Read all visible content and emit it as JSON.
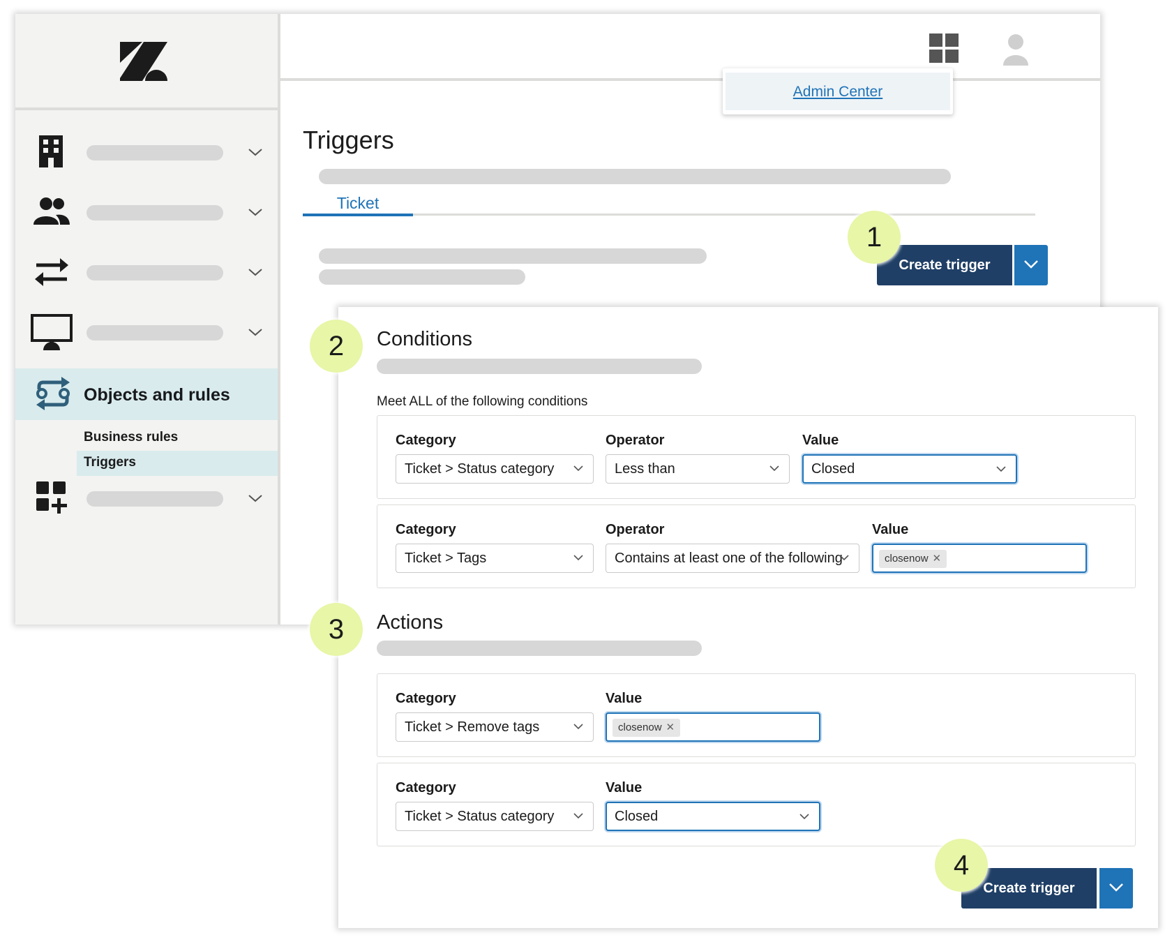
{
  "sidebar": {
    "active_section": "Objects and rules",
    "sub_items": [
      "Business rules",
      "Triggers"
    ],
    "icons": [
      "building-icon",
      "people-icon",
      "arrows-icon",
      "monitor-icon",
      "objects-rules-icon",
      "apps-add-icon"
    ]
  },
  "header": {
    "apps_icon": "grid-icon",
    "user_icon": "user-icon",
    "popover_link": "Admin Center"
  },
  "page": {
    "title": "Triggers",
    "tab": "Ticket",
    "create_button": "Create trigger"
  },
  "badges": [
    "1",
    "2",
    "3",
    "4"
  ],
  "conditions": {
    "title": "Conditions",
    "instruction": "Meet ALL of the following conditions",
    "rows": [
      {
        "category_label": "Category",
        "category": "Ticket > Status category",
        "operator_label": "Operator",
        "operator": "Less than",
        "value_label": "Value",
        "value": "Closed"
      },
      {
        "category_label": "Category",
        "category": "Ticket > Tags",
        "operator_label": "Operator",
        "operator": "Contains at least one of the following",
        "value_label": "Value",
        "tag": "closenow"
      }
    ]
  },
  "actions": {
    "title": "Actions",
    "rows": [
      {
        "category_label": "Category",
        "category": "Ticket > Remove tags",
        "value_label": "Value",
        "tag": "closenow"
      },
      {
        "category_label": "Category",
        "category": "Ticket > Status category",
        "value_label": "Value",
        "value": "Closed"
      }
    ]
  },
  "footer": {
    "create_button": "Create trigger"
  },
  "colors": {
    "primary": "#1f3f66",
    "accent": "#1f73b7",
    "badge": "#e7f6a7",
    "active_nav": "#d9ebed"
  }
}
